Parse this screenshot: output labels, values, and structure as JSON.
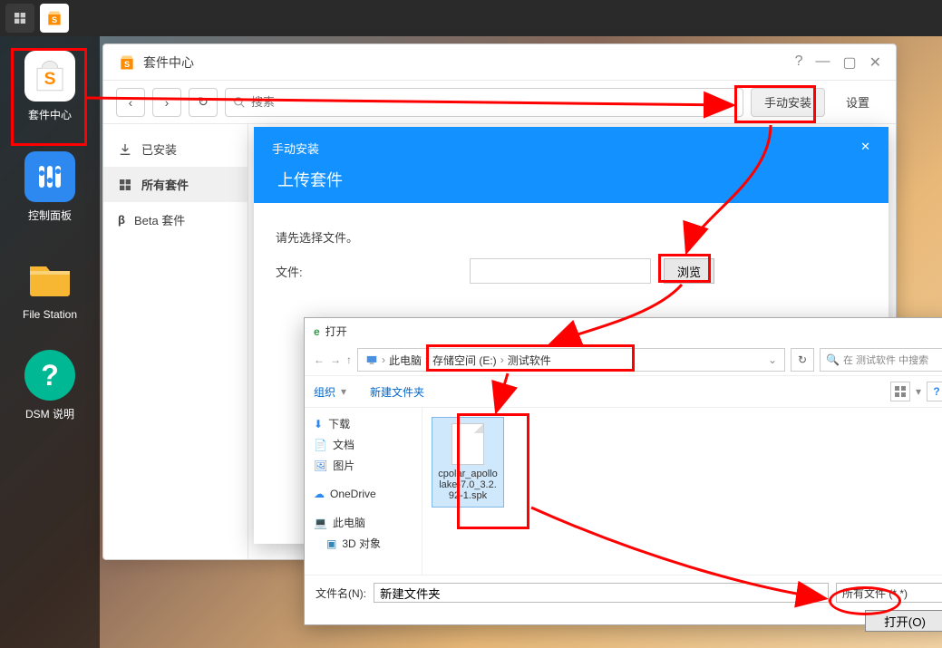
{
  "taskbar": {},
  "dock": {
    "items": [
      {
        "label": "套件中心"
      },
      {
        "label": "控制面板"
      },
      {
        "label": "File Station"
      },
      {
        "label": "DSM 说明"
      }
    ]
  },
  "pkg_center": {
    "title": "套件中心",
    "search_placeholder": "搜索",
    "manual_install": "手动安装",
    "settings": "设置",
    "sidebar": [
      {
        "label": "已安装"
      },
      {
        "label": "所有套件"
      },
      {
        "label": "Beta 套件"
      }
    ]
  },
  "upload": {
    "header_small": "手动安装",
    "header_title": "上传套件",
    "prompt": "请先选择文件。",
    "file_label": "文件:",
    "browse": "浏览"
  },
  "fileopen": {
    "title": "打开",
    "crumbs": [
      "此电脑",
      "存储空间 (E:)",
      "测试软件"
    ],
    "organize": "组织",
    "new_folder": "新建文件夹",
    "search_placeholder": "在 测试软件 中搜索",
    "tree": [
      {
        "label": "下载"
      },
      {
        "label": "文档"
      },
      {
        "label": "图片"
      },
      {
        "label": "OneDrive"
      },
      {
        "label": "此电脑"
      },
      {
        "label": "3D 对象"
      }
    ],
    "file": "cpolar_apollolake-7.0_3.2.92-1.spk",
    "filename_label": "文件名(N):",
    "filename_value": "新建文件夹",
    "filter": "所有文件 (*.*)",
    "open_btn": "打开(O)"
  }
}
